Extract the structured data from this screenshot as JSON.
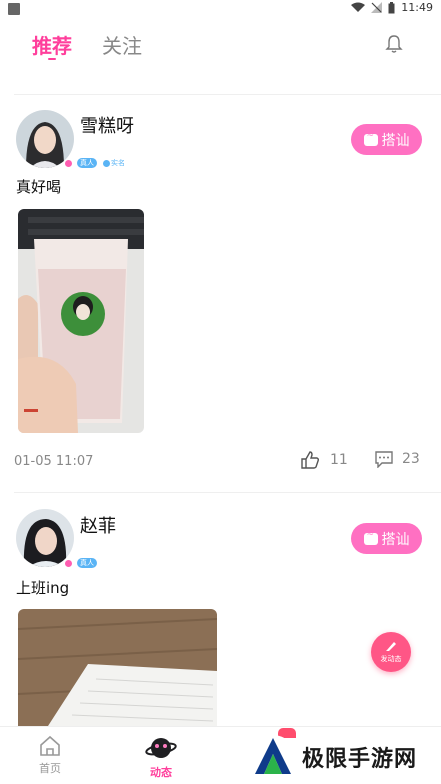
{
  "status_bar": {
    "time": "11:49"
  },
  "header": {
    "tabs": [
      {
        "label": "推荐"
      },
      {
        "label": "关注"
      }
    ]
  },
  "posts": [
    {
      "username": "雪糕呀",
      "badge_real": "真人",
      "badge_name": "实名",
      "chat_label": "搭讪",
      "text": "真好喝",
      "date": "01-05 11:07",
      "likes": "11",
      "comments": "23"
    },
    {
      "username": "赵菲",
      "badge_real": "真人",
      "chat_label": "搭讪",
      "text": "上班ing"
    }
  ],
  "fab": {
    "label": "发动态"
  },
  "bottom_nav": {
    "items": [
      {
        "label": "首页"
      },
      {
        "label": "动态"
      }
    ]
  },
  "watermark": {
    "text": "极限手游网"
  },
  "colors": {
    "accent": "#ff3f9c",
    "chat_button": "#ff70c2",
    "badge_blue": "#5ab4f5",
    "fab": "#ff5686"
  }
}
